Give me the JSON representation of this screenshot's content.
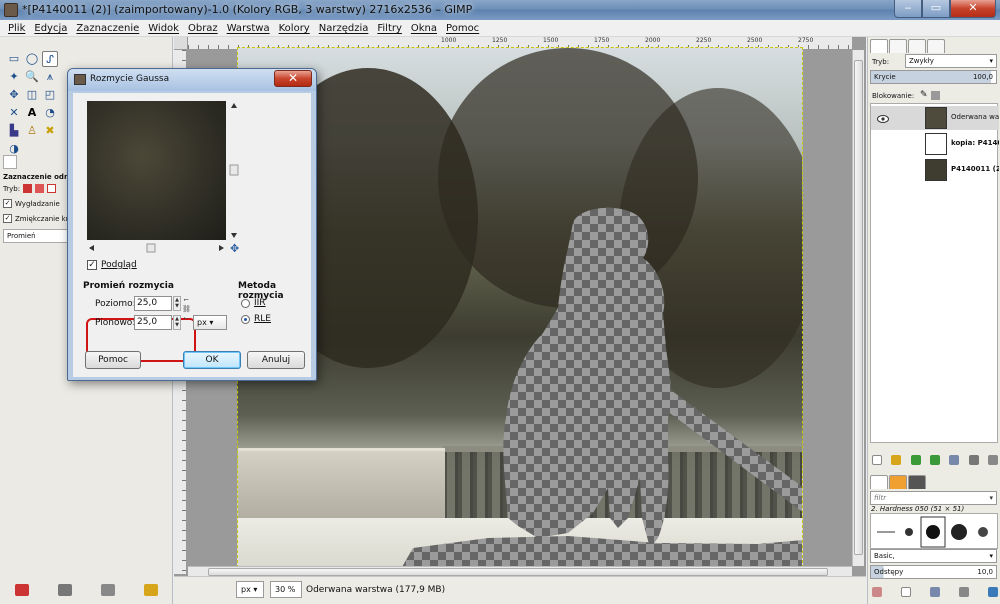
{
  "window": {
    "title": "*[P4140011 (2)] (zaimportowany)-1.0 (Kolory RGB, 3 warstwy) 2716x2536 – GIMP"
  },
  "menu": [
    "Plik",
    "Edycja",
    "Zaznaczenie",
    "Widok",
    "Obraz",
    "Warstwa",
    "Kolory",
    "Narzędzia",
    "Filtry",
    "Okna",
    "Pomoc"
  ],
  "tool_options": {
    "title": "Zaznaczenie odręczne",
    "mode_label": "Tryb:",
    "antialias_label": "Wygładzanie",
    "feather_label": "Zmiękczanie krawędzi",
    "radius_label": "Promień"
  },
  "ruler": {
    "ticks": [
      "1000",
      "1250",
      "1500",
      "1750",
      "2000",
      "2250",
      "2500",
      "2750"
    ]
  },
  "status": {
    "unit": "px",
    "zoom": "30 %",
    "layer_info": "Oderwana warstwa (177,9 MB)"
  },
  "layers_dock": {
    "mode_label": "Tryb:",
    "mode_value": "Zwykły",
    "opacity_label": "Krycie",
    "opacity_value": "100,0",
    "lock_label": "Blokowanie:",
    "layers": [
      {
        "name": "Oderwana warstwa",
        "selected": true
      },
      {
        "name": "kopia: P4140011",
        "selected": false
      },
      {
        "name": "P4140011 (2).",
        "selected": false
      }
    ]
  },
  "brushes_dock": {
    "filter_placeholder": "filtr",
    "brush_name": "2. Hardness 050 (51 × 51)",
    "preset": "Basic,",
    "spacing_label": "Odstępy",
    "spacing_value": "10,0"
  },
  "dialog": {
    "title": "Rozmycie Gaussa",
    "preview_label": "Podgląd",
    "radius_section": "Promień rozmycia",
    "horizontal_label": "Poziomo:",
    "horizontal_value": "25,0",
    "vertical_label": "Pionowo:",
    "vertical_value": "25,0",
    "unit": "px",
    "method_section": "Metoda rozmycia",
    "method_iir": "IIR",
    "method_rle": "RLE",
    "method_selected": "RLE",
    "help_button": "Pomoc",
    "ok_button": "OK",
    "cancel_button": "Anuluj"
  },
  "colors": {
    "highlight_ring": "#d01414",
    "close_button": "#c9462d"
  }
}
